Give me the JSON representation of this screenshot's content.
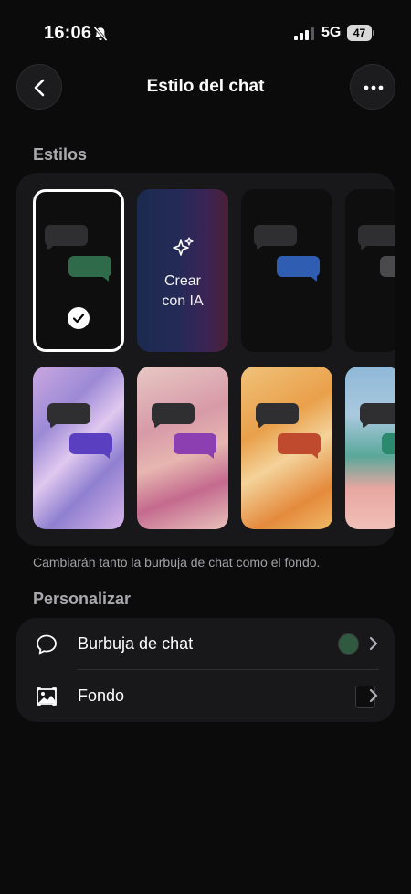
{
  "status_bar": {
    "time": "16:06",
    "network": "5G",
    "battery": "47"
  },
  "header": {
    "title": "Estilo del chat",
    "back_icon": "chevron-left-icon",
    "more_icon": "ellipsis-icon"
  },
  "styles": {
    "section_label": "Estilos",
    "selected_index": 0,
    "create_ai_label_line1": "Crear",
    "create_ai_label_line2": "con IA",
    "helper_text": "Cambiarán tanto la burbuja de chat como el fondo.",
    "themes": [
      {
        "name": "black",
        "bubble_color": "#2f6b4a"
      },
      {
        "name": "create-ai"
      },
      {
        "name": "black-blue",
        "bubble_color": "#2f5db1"
      },
      {
        "name": "black-gray",
        "bubble_color": "#4a4a4c"
      },
      {
        "name": "iridescent",
        "bubble_color": "#5a3fc0"
      },
      {
        "name": "flowers",
        "bubble_color": "#8b3fb0"
      },
      {
        "name": "orange-silk",
        "bubble_color": "#c04a2e"
      },
      {
        "name": "beach",
        "bubble_color": "#2b8a6d"
      }
    ]
  },
  "personalize": {
    "section_label": "Personalizar",
    "rows": [
      {
        "label": "Burbuja de chat",
        "icon": "chat-bubble-icon",
        "swatch_color": "#2f5a40"
      },
      {
        "label": "Fondo",
        "icon": "image-icon",
        "swatch_color": "#0d0d0d"
      }
    ]
  }
}
